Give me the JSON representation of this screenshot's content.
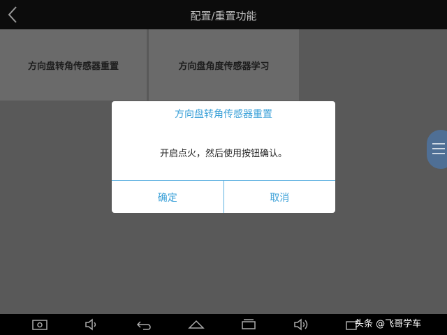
{
  "header": {
    "title": "配置/重置功能",
    "back_icon": "chevron-left-icon"
  },
  "tiles": [
    {
      "label": "方向盘转角传感器重置"
    },
    {
      "label": "方向盘角度传感器学习"
    }
  ],
  "side_menu": {
    "icon": "hamburger-menu-icon"
  },
  "dialog": {
    "title": "方向盘转角传感器重置",
    "message": "开启点火，然后使用按钮确认。",
    "confirm_label": "确定",
    "cancel_label": "取消"
  },
  "navbar": {
    "icons": [
      "screenshot-icon",
      "volume-down-icon",
      "back-icon",
      "home-icon",
      "recent-apps-icon",
      "volume-up-icon",
      "add-window-icon"
    ]
  },
  "watermark": {
    "text": "头条 @飞哥学车"
  },
  "colors": {
    "accent": "#3aa0d8",
    "overlay": "#595959",
    "header_bg": "#0c0c0c"
  }
}
